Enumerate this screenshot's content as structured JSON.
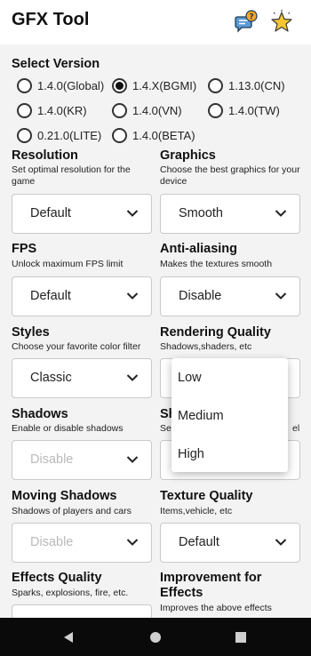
{
  "app": {
    "title": "GFX Tool"
  },
  "header_icons": {
    "chat": "chat-help-icon",
    "star": "star-icon"
  },
  "version": {
    "title": "Select Version",
    "options": [
      "1.4.0(Global)",
      "1.4.X(BGMI)",
      "1.13.0(CN)",
      "1.4.0(KR)",
      "1.4.0(VN)",
      "1.4.0(TW)",
      "0.21.0(LITE)",
      "1.4.0(BETA)"
    ],
    "selected": "1.4.X(BGMI)"
  },
  "settings": {
    "resolution": {
      "title": "Resolution",
      "subtitle": "Set optimal resolution for the game",
      "value": "Default"
    },
    "graphics": {
      "title": "Graphics",
      "subtitle": "Choose the best graphics for your device",
      "value": "Smooth"
    },
    "fps": {
      "title": "FPS",
      "subtitle": "Unlock maximum FPS limit",
      "value": "Default"
    },
    "anti_aliasing": {
      "title": "Anti-aliasing",
      "subtitle": "Makes the textures smooth",
      "value": "Disable"
    },
    "styles": {
      "title": "Styles",
      "subtitle": "Choose your favorite color filter",
      "value": "Classic"
    },
    "rendering_quality": {
      "title": "Rendering Quality",
      "subtitle": "Shadows,shaders, etc",
      "value": ""
    },
    "shadows": {
      "title": "Shadows",
      "subtitle": "Enable or disable shadows",
      "value": "Disable"
    },
    "shadow_distance": {
      "title": "Sh",
      "subtitle": "Sel",
      "subtitle_end": "el",
      "value": ""
    },
    "moving_shadows": {
      "title": "Moving Shadows",
      "subtitle": "Shadows of players and cars",
      "value": "Disable"
    },
    "texture_quality": {
      "title": "Texture Quality",
      "subtitle": "Items,vehicle, etc",
      "value": "Default"
    },
    "effects_quality": {
      "title": "Effects Quality",
      "subtitle": "Sparks, explosions, fire, etc."
    },
    "improvement_effects": {
      "title_line1": "Improvement for",
      "title_line2": "Effects",
      "subtitle": "Improves the above effects"
    }
  },
  "rendering_menu": {
    "options": [
      "Low",
      "Medium",
      "High"
    ]
  },
  "nav": {
    "back": "back-triangle-icon",
    "home": "home-circle-icon",
    "recents": "recents-square-icon"
  },
  "colors": {
    "background": "#f3f3f3",
    "header": "#ffffff",
    "navbar": "#0a0a0a",
    "disabled_text": "#b9b9b9"
  }
}
